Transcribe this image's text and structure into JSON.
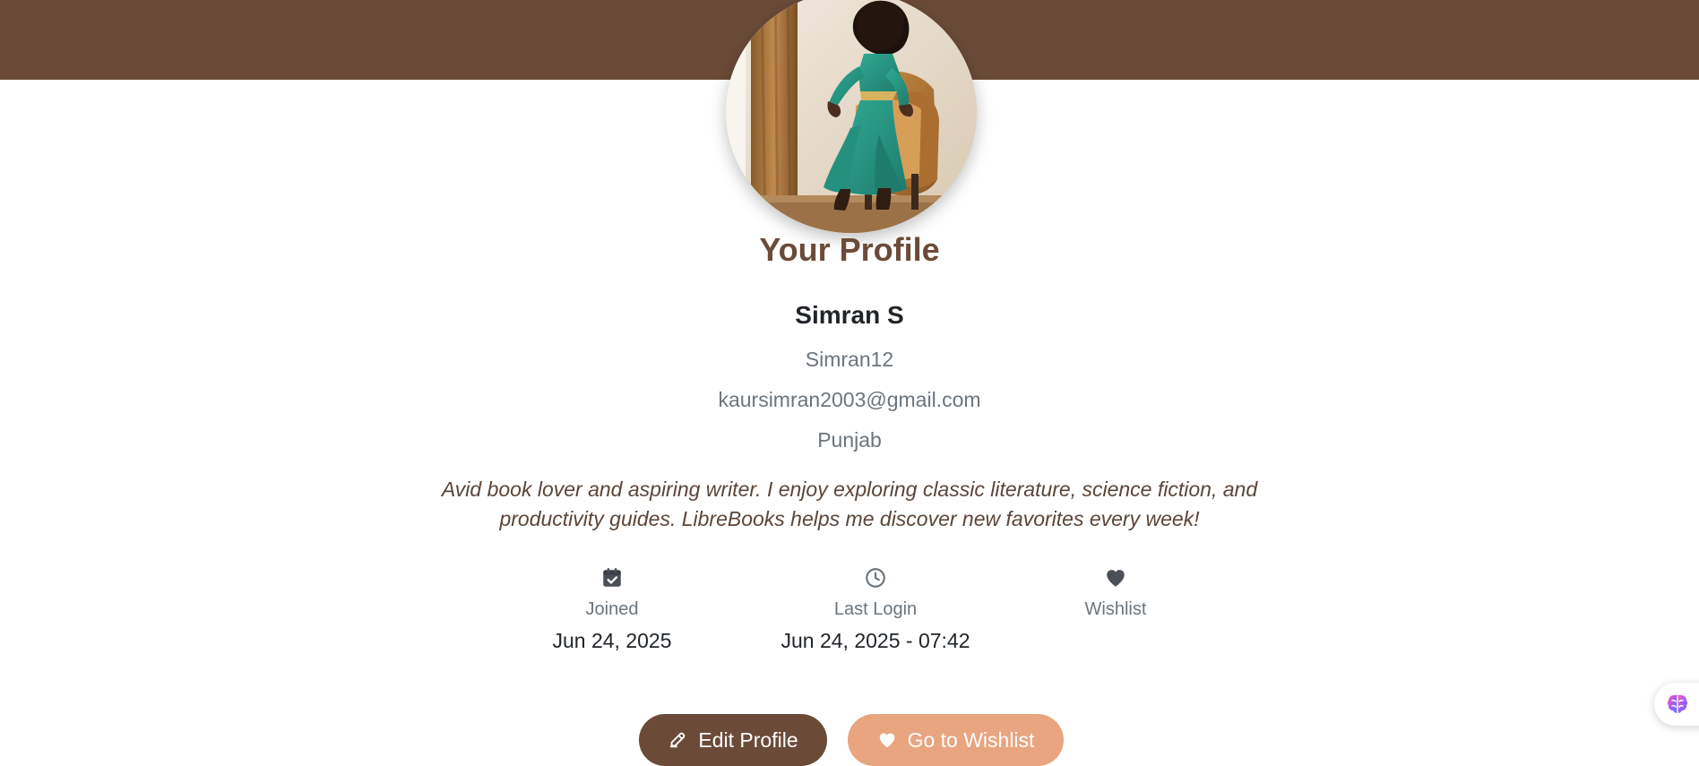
{
  "colors": {
    "banner": "#6b4b38",
    "title": "#6b4b38",
    "edit_button": "#6b4b38",
    "wishlist_button": "#e8a57f",
    "muted_text": "#6c757d",
    "bio_text": "#5b4539"
  },
  "page": {
    "title": "Your Profile"
  },
  "profile": {
    "full_name": "Simran S",
    "username": "Simran12",
    "email": "kaursimran2003@gmail.com",
    "location": "Punjab",
    "bio": "Avid book lover and aspiring writer. I enjoy exploring classic literature, science fiction, and productivity guides. LibreBooks helps me discover new favorites every week!"
  },
  "stats": {
    "joined": {
      "icon": "calendar-check-icon",
      "label": "Joined",
      "value": "Jun 24, 2025"
    },
    "last_login": {
      "icon": "clock-icon",
      "label": "Last Login",
      "value": "Jun 24, 2025 - 07:42"
    },
    "wishlist": {
      "icon": "heart-icon",
      "label": "Wishlist",
      "value": ""
    }
  },
  "actions": {
    "edit_profile": {
      "icon": "edit-icon",
      "label": "Edit Profile"
    },
    "go_to_wishlist": {
      "icon": "heart-icon",
      "label": "Go to Wishlist"
    }
  },
  "floating_button": {
    "icon": "brain-icon"
  }
}
